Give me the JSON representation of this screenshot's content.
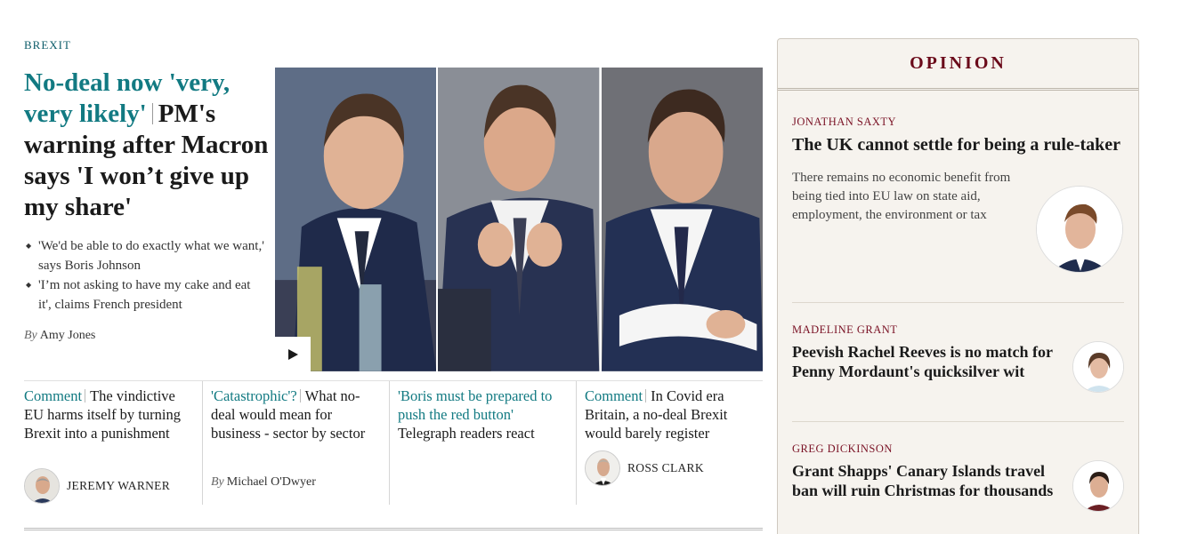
{
  "section": {
    "label": "BREXIT"
  },
  "lead": {
    "kicker": "No-deal now 'very, very likely'",
    "headline": "PM's warning after Macron says 'I won’t give up my share'",
    "bullets": [
      "'We'd be able to do exactly what we want,' says Boris Johnson",
      "'I’m not asking to have my cake and eat it', claims French president"
    ],
    "byline_prefix": "By",
    "byline_name": "Amy Jones",
    "play_icon": "play-icon"
  },
  "stories": [
    {
      "kicker": "Comment",
      "headline": "The vindictive EU harms itself by turning Brexit into a punishment",
      "author": "JEREMY WARNER"
    },
    {
      "kicker": "'Catastrophic'?",
      "headline": "What no-deal would mean for business - sector by sector",
      "byline_prefix": "By",
      "byline_name": "Michael O'Dwyer"
    },
    {
      "kicker": "'Boris must be prepared to push the red button'",
      "headline": "Telegraph readers react"
    },
    {
      "kicker": "Comment",
      "headline": "In Covid era Britain, a no-deal Brexit would barely register",
      "author": "ROSS CLARK"
    }
  ],
  "opinion": {
    "title": "OPINION",
    "items": [
      {
        "author": "JONATHAN SAXTY",
        "headline": "The UK cannot settle for being a rule-taker",
        "standfirst": "There remains no economic benefit from being tied into EU law on state aid, employment, the environment or tax"
      },
      {
        "author": "MADELINE GRANT",
        "headline": "Peevish Rachel Reeves is no match for Penny Mordaunt's quicksilver wit"
      },
      {
        "author": "GREG DICKINSON",
        "headline": "Grant Shapps' Canary Islands travel ban will ruin Christmas for thousands"
      }
    ]
  },
  "colors": {
    "teal": "#127a82",
    "opinion_red": "#6a0a1a",
    "opinion_bg": "#f6f3ee"
  }
}
